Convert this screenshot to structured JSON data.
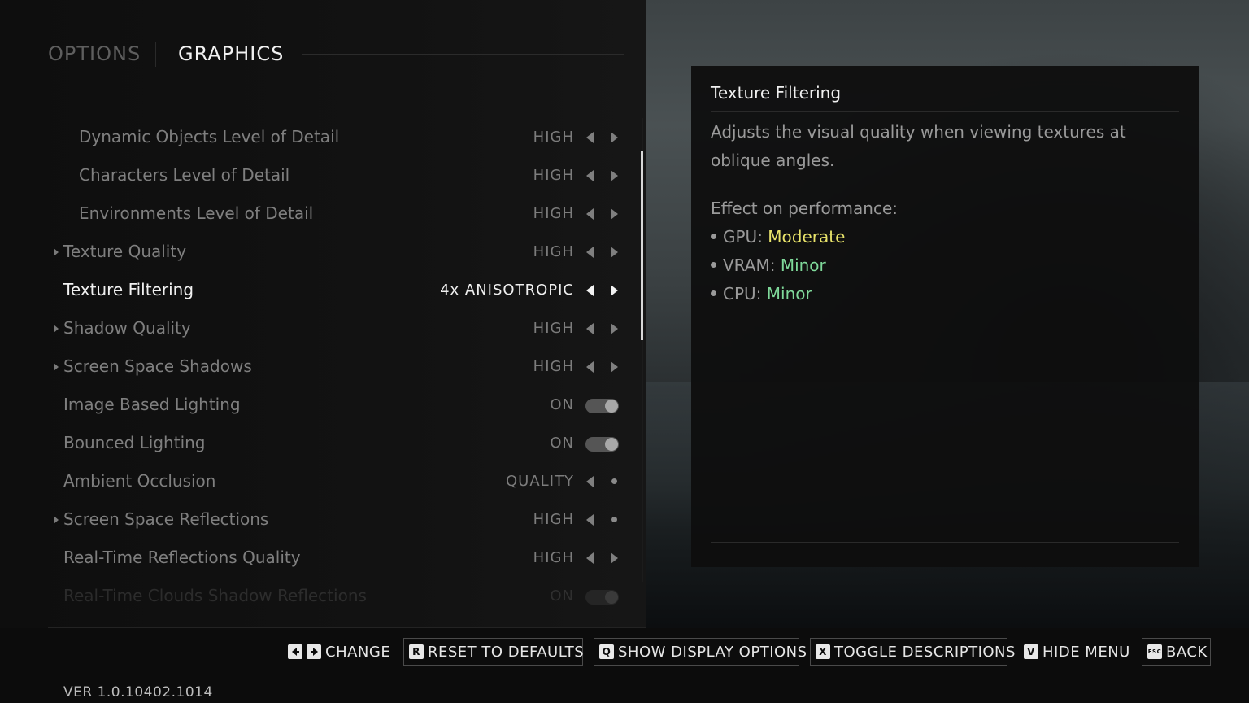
{
  "header": {
    "tab_options": "OPTIONS",
    "tab_graphics": "GRAPHICS"
  },
  "settings": [
    {
      "label": "Dynamic Objects Level of Detail",
      "value": "HIGH",
      "control": "arrows",
      "indent": 2
    },
    {
      "label": "Characters Level of Detail",
      "value": "HIGH",
      "control": "arrows",
      "indent": 2
    },
    {
      "label": "Environments Level of Detail",
      "value": "HIGH",
      "control": "arrows",
      "indent": 2
    },
    {
      "label": "Texture Quality",
      "value": "HIGH",
      "control": "arrows",
      "indent": 1,
      "expandable": true
    },
    {
      "label": "Texture Filtering",
      "value": "4x ANISOTROPIC",
      "control": "arrows",
      "indent": 1,
      "selected": true
    },
    {
      "label": "Shadow Quality",
      "value": "HIGH",
      "control": "arrows",
      "indent": 1,
      "expandable": true
    },
    {
      "label": "Screen Space Shadows",
      "value": "HIGH",
      "control": "arrows",
      "indent": 1,
      "expandable": true
    },
    {
      "label": "Image Based Lighting",
      "value": "ON",
      "control": "toggle",
      "indent": 1
    },
    {
      "label": "Bounced Lighting",
      "value": "ON",
      "control": "toggle",
      "indent": 1
    },
    {
      "label": "Ambient Occlusion",
      "value": "QUALITY",
      "control": "arrow-dot",
      "indent": 1
    },
    {
      "label": "Screen Space Reflections",
      "value": "HIGH",
      "control": "arrow-dot",
      "indent": 1,
      "expandable": true
    },
    {
      "label": "Real-Time Reflections Quality",
      "value": "HIGH",
      "control": "arrows",
      "indent": 1
    },
    {
      "label": "Real-Time Clouds Shadow Reflections",
      "value": "ON",
      "control": "toggle",
      "indent": 1,
      "faded": true
    }
  ],
  "description": {
    "title": "Texture Filtering",
    "body": "Adjusts the visual quality when viewing textures at oblique angles.",
    "performance_heading": "Effect on performance:",
    "performance": [
      {
        "name": "GPU:",
        "level": "Moderate",
        "color": "#e8e36a"
      },
      {
        "name": "VRAM:",
        "level": "Minor",
        "color": "#7fd99a"
      },
      {
        "name": "CPU:",
        "level": "Minor",
        "color": "#7fd99a"
      }
    ]
  },
  "hints": {
    "change": "CHANGE",
    "reset_key": "R",
    "reset": "RESET TO DEFAULTS",
    "display_key": "Q",
    "display": "SHOW DISPLAY OPTIONS",
    "toggle_key": "X",
    "toggle": "TOGGLE DESCRIPTIONS",
    "hide_key": "V",
    "hide": "HIDE MENU",
    "back_key": "ESC",
    "back": "BACK"
  },
  "version": "VER 1.0.10402.1014"
}
